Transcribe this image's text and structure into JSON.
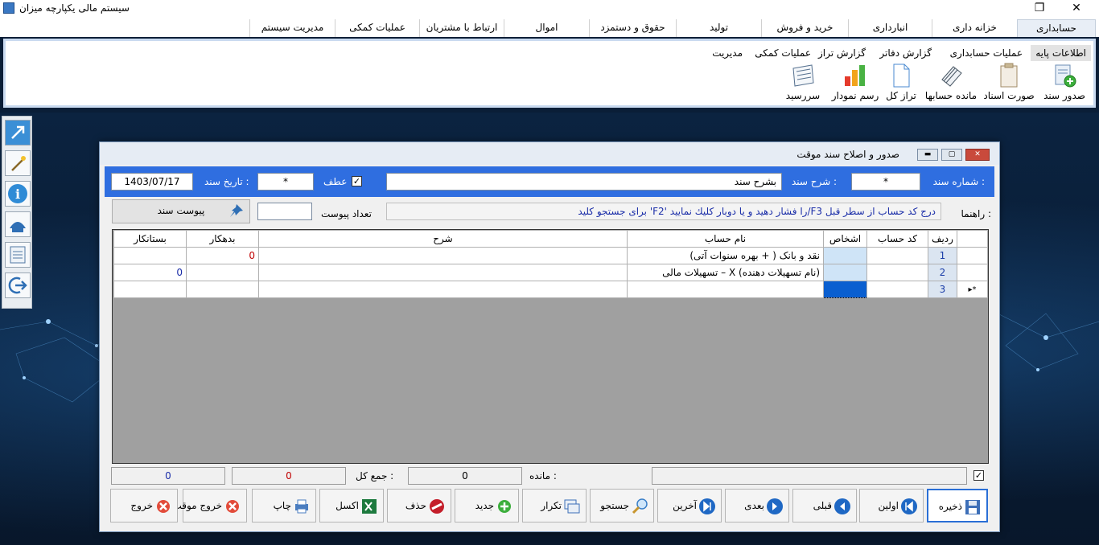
{
  "app": {
    "title": "سیستم مالی یکپارچه میزان"
  },
  "menu": {
    "tabs": [
      "حسابداری",
      "خزانه داری",
      "انبارداری",
      "خرید و فروش",
      "تولید",
      "حقوق و دستمزد",
      "اموال",
      "ارتباط با مشتریان",
      "عملیات کمکی",
      "مدیریت سیستم"
    ]
  },
  "ribbon": {
    "subtabs": [
      "اطلاعات پایه",
      "عملیات حسابداری",
      "گزارش دفاتر",
      "گزارش تراز",
      "عملیات کمکی",
      "مدیریت"
    ],
    "buttons": [
      "صدور سند",
      "صورت اسناد",
      "مانده حسابها",
      "تراز کل",
      "رسم نمودار",
      "سررسید"
    ]
  },
  "dialog": {
    "title": "صدور و اصلاح سند موقت",
    "doc_number_label": "شماره سند :",
    "doc_number_value": "*",
    "doc_desc_label": "شرح سند :",
    "doc_desc_value": "بشرح سند",
    "atf_label": "عطف",
    "atf_checked": "✓",
    "atf_value": "*",
    "doc_date_label": "تاریخ سند :",
    "doc_date_value": "1403/07/17",
    "guide_label": "راهنما :",
    "guide_text": "برای جستجو کلید 'F2' را فشار دهید و یا دوبار کلیك نمایید/F3 درج کد حساب از سطر قبل",
    "attach_count_label": "تعداد پیوست",
    "attach_count_value": "",
    "attach_button": "پیوست سند"
  },
  "grid": {
    "columns": [
      "ردیف",
      "کد حساب",
      "اشخاص",
      "نام حساب",
      "شرح",
      "بدهکار",
      "بستانکار"
    ],
    "rows": [
      {
        "row": "1",
        "code": "",
        "person": "",
        "account": "نقد و بانک ( + بهره سنوات آتی)",
        "desc": "",
        "debit": "0",
        "credit": ""
      },
      {
        "row": "2",
        "code": "",
        "person": "",
        "account": "تسهیلات مالی – X (نام تسهیلات دهنده)",
        "desc": "",
        "debit": "",
        "credit": "0"
      },
      {
        "row": "3",
        "code": "",
        "person": "",
        "account": "",
        "desc": "",
        "debit": "",
        "credit": "",
        "marker": "▸*"
      }
    ]
  },
  "totals": {
    "remaining_label": "مانده :",
    "remaining_value": "0",
    "sum_label": "جمع کل :",
    "sum_debit": "0",
    "sum_credit": "0",
    "check_mark": "✓"
  },
  "buttons": [
    "ذخیره",
    "اولین",
    "قبلی",
    "بعدی",
    "آخرین",
    "جستجو",
    "تکرار",
    "جدید",
    "حذف",
    "اکسل",
    "چاپ",
    "خروج موقت",
    "خروج"
  ],
  "colors": {
    "accent_band": "#2f6ee0",
    "debit_color": "#c00000",
    "credit_color": "#1a2da8"
  }
}
